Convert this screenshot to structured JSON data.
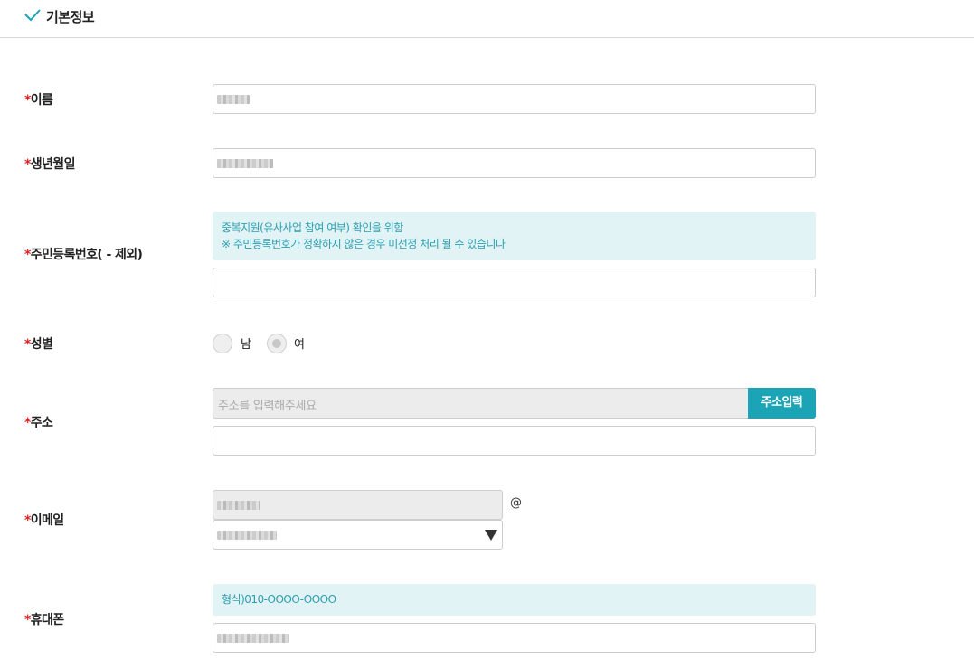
{
  "section": {
    "title": "기본정보",
    "icon": "check-icon"
  },
  "required_mark": "*",
  "fields": {
    "name": {
      "label": "이름"
    },
    "birth": {
      "label": "생년월일"
    },
    "resident": {
      "label": "주민등록번호( - 제외)",
      "notice_line1": "중복지원(유사사업 참여 여부) 확인을 위함",
      "notice_line2": "※ 주민등록번호가 정확하지 않은 경우 미선정 처리 될 수 있습니다"
    },
    "gender": {
      "label": "성별",
      "options": [
        "남",
        "여"
      ],
      "selected": "여"
    },
    "address": {
      "label": "주소",
      "placeholder": "주소를 입력해주세요",
      "button": "주소입력"
    },
    "email": {
      "label": "이메일",
      "at": "@"
    },
    "phone": {
      "label": "휴대폰",
      "notice": "형식)010-OOOO-OOOO"
    }
  },
  "colors": {
    "accent": "#1aa4b5",
    "required": "#e02020",
    "notice_bg": "#e2f3f6",
    "notice_text": "#2a9fb0"
  }
}
